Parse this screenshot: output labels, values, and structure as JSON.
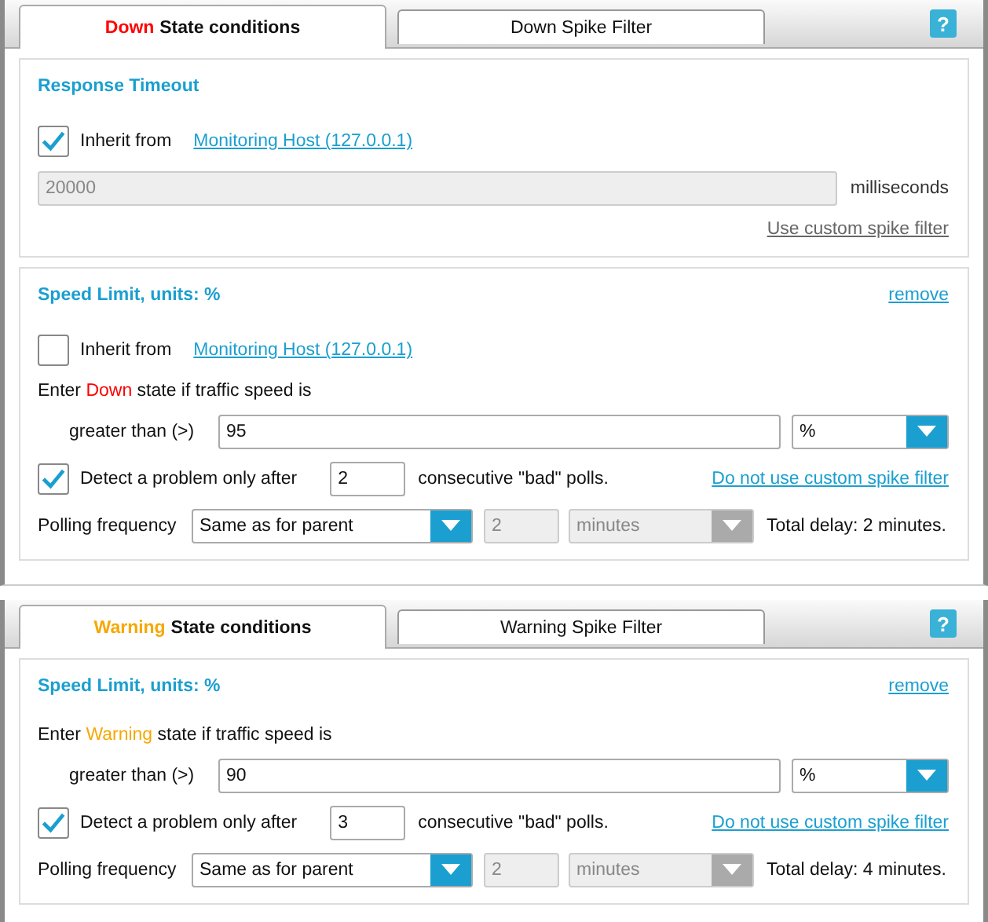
{
  "panels": [
    {
      "color": "#ff0000",
      "help": "?",
      "tabs": [
        {
          "accent": "Down",
          "label": "State conditions",
          "selected": true
        },
        {
          "label": "Down Spike Filter",
          "selected": false
        }
      ],
      "sections": [
        {
          "title": "Response Timeout",
          "inherit": {
            "checked": true,
            "label": "Inherit from",
            "link": "Monitoring Host (127.0.0.1)"
          },
          "timeout": {
            "value": "20000",
            "disabled": true,
            "unit": "milliseconds"
          },
          "spike_link": {
            "text": "Use custom spike filter",
            "disabled": true
          }
        },
        {
          "title": "Speed Limit, units: %",
          "remove": "remove",
          "inherit": {
            "checked": false,
            "label": "Inherit from",
            "link": "Monitoring Host (127.0.0.1)"
          },
          "condition": {
            "before": "Enter",
            "accent": "Down",
            "after": "state if traffic speed is"
          },
          "comparison": {
            "label": "greater than (>)",
            "value": "95",
            "unit": "%"
          },
          "detect": {
            "checked": true,
            "label": "Detect a problem only after",
            "value": "2",
            "suffix": "consecutive \"bad\" polls."
          },
          "spike_link": {
            "text": "Do not use custom spike filter",
            "disabled": false
          },
          "polling": {
            "label": "Polling frequency",
            "mode": "Same as for parent",
            "count": "2",
            "unit": "minutes",
            "disabled": true,
            "total": "Total delay: 2 minutes."
          }
        }
      ]
    },
    {
      "color": "#f5a800",
      "help": "?",
      "tabs": [
        {
          "accent": "Warning",
          "label": "State conditions",
          "selected": true
        },
        {
          "label": "Warning Spike Filter",
          "selected": false
        }
      ],
      "sections": [
        {
          "title": "Speed Limit, units: %",
          "remove": "remove",
          "condition": {
            "before": "Enter",
            "accent": "Warning",
            "after": "state if traffic speed is"
          },
          "comparison": {
            "label": "greater than (>)",
            "value": "90",
            "unit": "%"
          },
          "detect": {
            "checked": true,
            "label": "Detect a problem only after",
            "value": "3",
            "suffix": "consecutive \"bad\" polls."
          },
          "spike_link": {
            "text": "Do not use custom spike filter",
            "disabled": false
          },
          "polling": {
            "label": "Polling frequency",
            "mode": "Same as for parent",
            "count": "2",
            "unit": "minutes",
            "disabled": true,
            "total": "Total delay: 4 minutes."
          }
        }
      ]
    }
  ]
}
